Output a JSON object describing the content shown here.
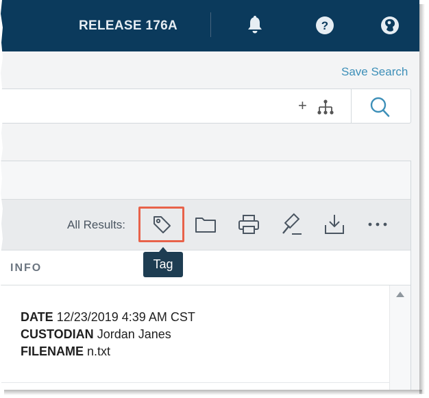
{
  "header": {
    "release_label": "RELEASE 176A",
    "icons": [
      "bell-icon",
      "help-icon",
      "user-avatar-icon"
    ]
  },
  "search": {
    "save_label": "Save Search",
    "query_value": "",
    "add_symbol": "+",
    "icons": [
      "hierarchy-tree-icon",
      "search-icon"
    ]
  },
  "toolbar": {
    "all_results_label": "All Results:",
    "icons": [
      "tag-icon",
      "folder-icon",
      "print-icon",
      "gavel-icon",
      "download-icon",
      "more-icon"
    ],
    "tooltip": "Tag",
    "highlight_color": "#e8624a"
  },
  "table": {
    "column_header": "INFO",
    "rows": [
      {
        "fields": [
          {
            "label": "DATE",
            "value": "12/23/2019 4:39 AM CST"
          },
          {
            "label": "CUSTODIAN",
            "value": "Jordan Janes"
          },
          {
            "label": "FILENAME",
            "value": "n.txt"
          }
        ]
      }
    ]
  },
  "colors": {
    "header_bg": "#0b3a5c",
    "link": "#3d8fb8",
    "tooltip_bg": "#1e3d52"
  }
}
